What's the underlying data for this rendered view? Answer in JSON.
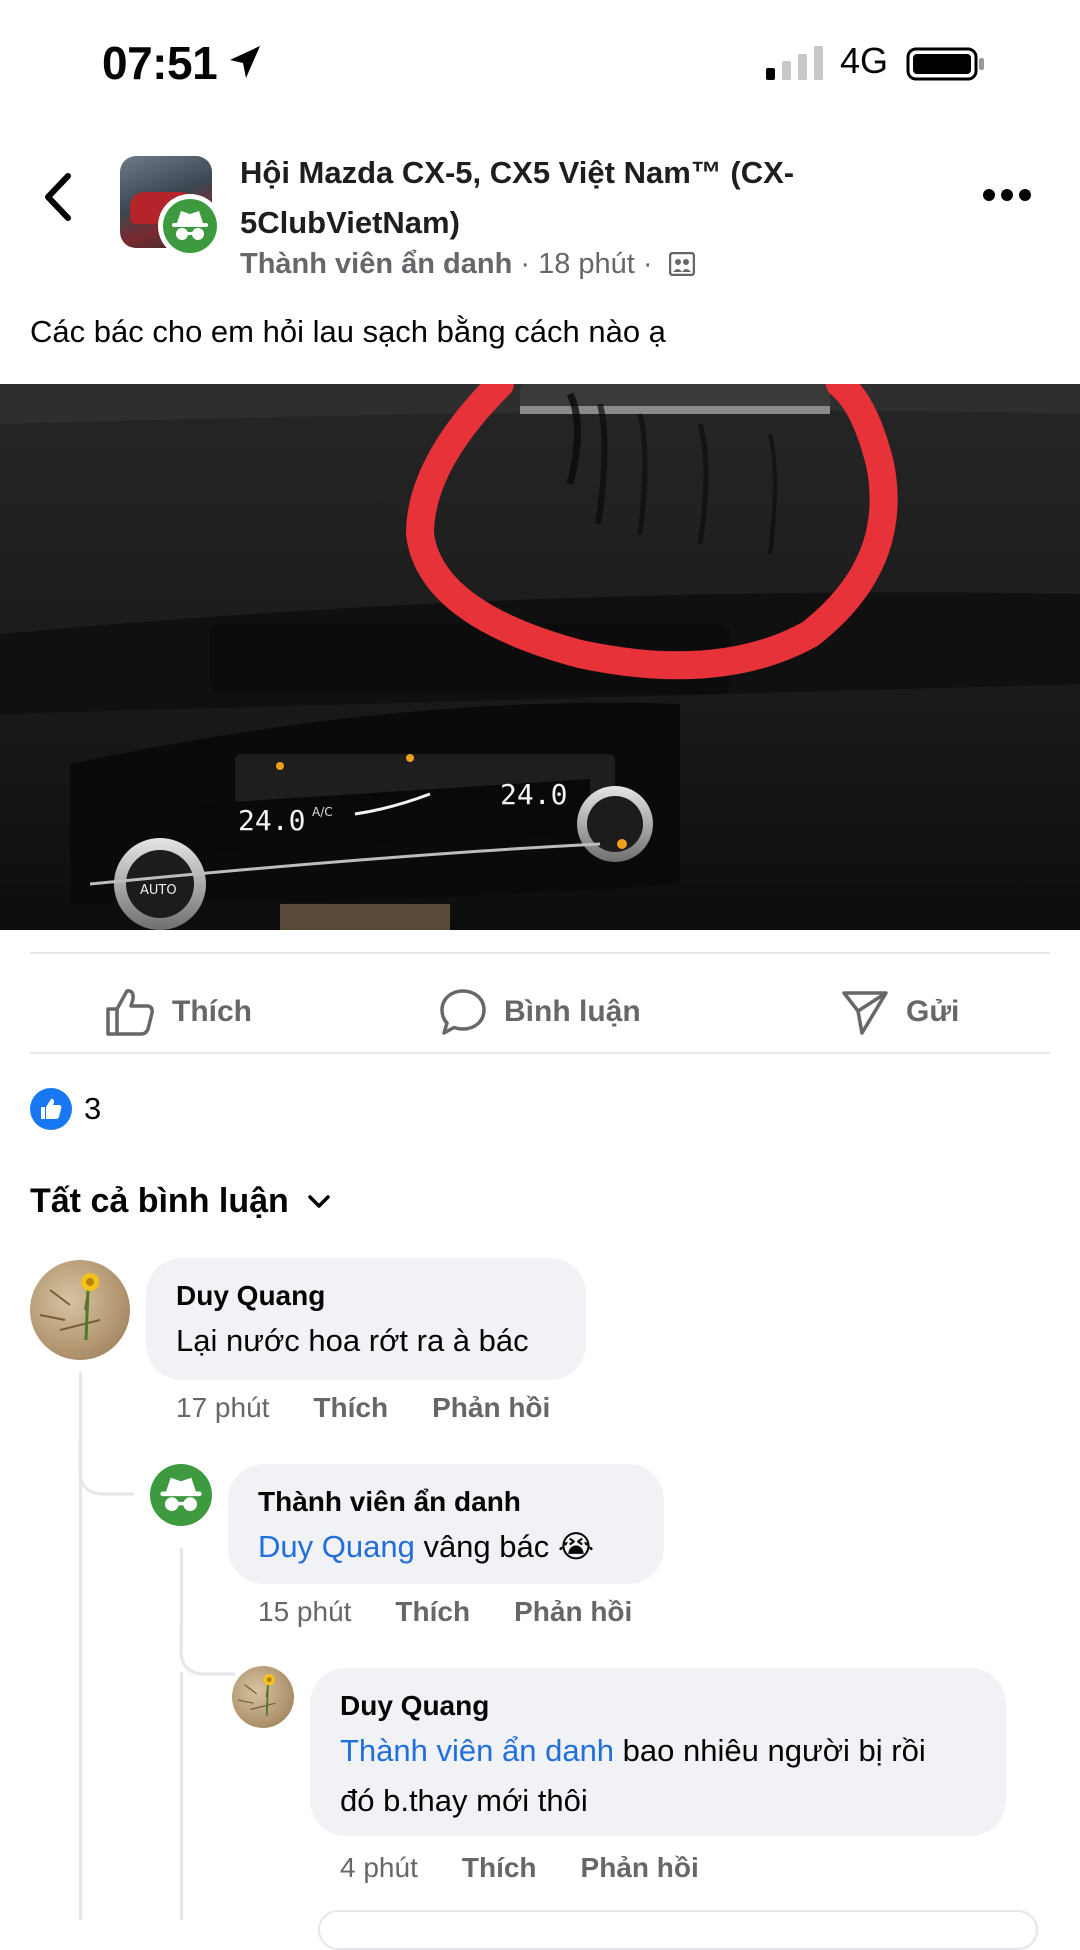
{
  "status_bar": {
    "time": "07:51",
    "network": "4G"
  },
  "post": {
    "group_name": "Hội Mazda CX-5, CX5 Việt Nam™ (CX-5ClubVietNam)",
    "author": "Thành viên ẩn danh",
    "separator": " · ",
    "time": "18 phút",
    "text": "Các bác cho em hỏi lau sạch bằng cách nào ạ",
    "climate_left_temp": "24.0",
    "climate_right_temp": "24.0",
    "auto_label": "AUTO",
    "ac_label": "A/C"
  },
  "actions": {
    "like": "Thích",
    "comment": "Bình luận",
    "send": "Gửi"
  },
  "reactions": {
    "count": "3"
  },
  "comments_header": "Tất cả bình luận",
  "comments": [
    {
      "author": "Duy Quang",
      "mention": "",
      "text": "Lại nước hoa rớt ra à bác",
      "time": "17 phút",
      "like": "Thích",
      "reply": "Phản hồi"
    },
    {
      "author": "Thành viên ẩn danh",
      "mention": "Duy Quang",
      "text": " vâng bác 😭",
      "time": "15 phút",
      "like": "Thích",
      "reply": "Phản hồi"
    },
    {
      "author": "Duy Quang",
      "mention": "Thành viên ẩn danh",
      "text_line1": " bao nhiêu người bị rồi",
      "text_line2": "đó b.thay mới thôi",
      "time": "4 phút",
      "like": "Thích",
      "reply": "Phản hồi"
    }
  ],
  "colors": {
    "accent": "#1877f2",
    "mention": "#216fdb",
    "secondary_text": "#65676b",
    "bubble": "#f0f2f5",
    "anon_green": "#3d9a3f",
    "highlight_circle": "#e8323a"
  },
  "icons": [
    "location-arrow-icon",
    "signal-icon",
    "battery-icon",
    "back-icon",
    "incognito-icon",
    "group-privacy-icon",
    "more-icon",
    "like-icon",
    "comment-icon",
    "send-icon",
    "chevron-down-icon"
  ]
}
